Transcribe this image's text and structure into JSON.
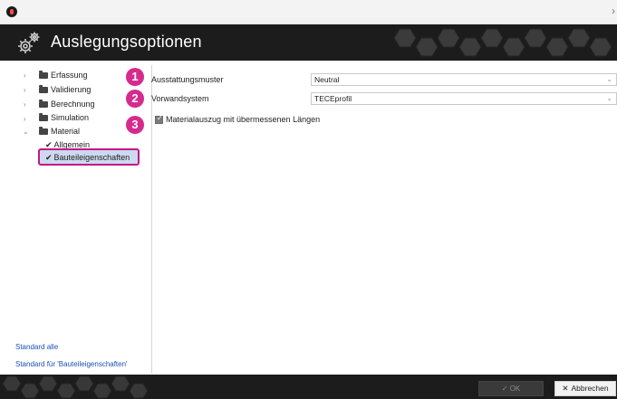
{
  "header": {
    "title": "Auslegungsoptionen"
  },
  "tree": {
    "items": [
      {
        "label": "Erfassung"
      },
      {
        "label": "Validierung"
      },
      {
        "label": "Berechnung"
      },
      {
        "label": "Simulation"
      },
      {
        "label": "Material"
      },
      {
        "label": "Allgemein"
      },
      {
        "label": "Bauteileigenschaften"
      }
    ]
  },
  "links": {
    "standard_all": "Standard alle",
    "standard_for": "Standard für 'Bauteileigenschaften'"
  },
  "badges": [
    "1",
    "2",
    "3"
  ],
  "form": {
    "ausstattung_label": "Ausstattungsmuster",
    "ausstattung_value": "Neutral",
    "vorwand_label": "Vorwandsystem",
    "vorwand_value": "TECEprofil",
    "material_checkbox_label": "Materialauszug mit übermessenen Längen",
    "material_checkbox_checked": true
  },
  "footer": {
    "ok_label": "OK",
    "cancel_label": "Abbrechen"
  },
  "colors": {
    "accent_badge": "#d62b8e",
    "highlight_border": "#c2188a",
    "header_bg": "#1c1c1c",
    "link": "#1a4fb8"
  }
}
